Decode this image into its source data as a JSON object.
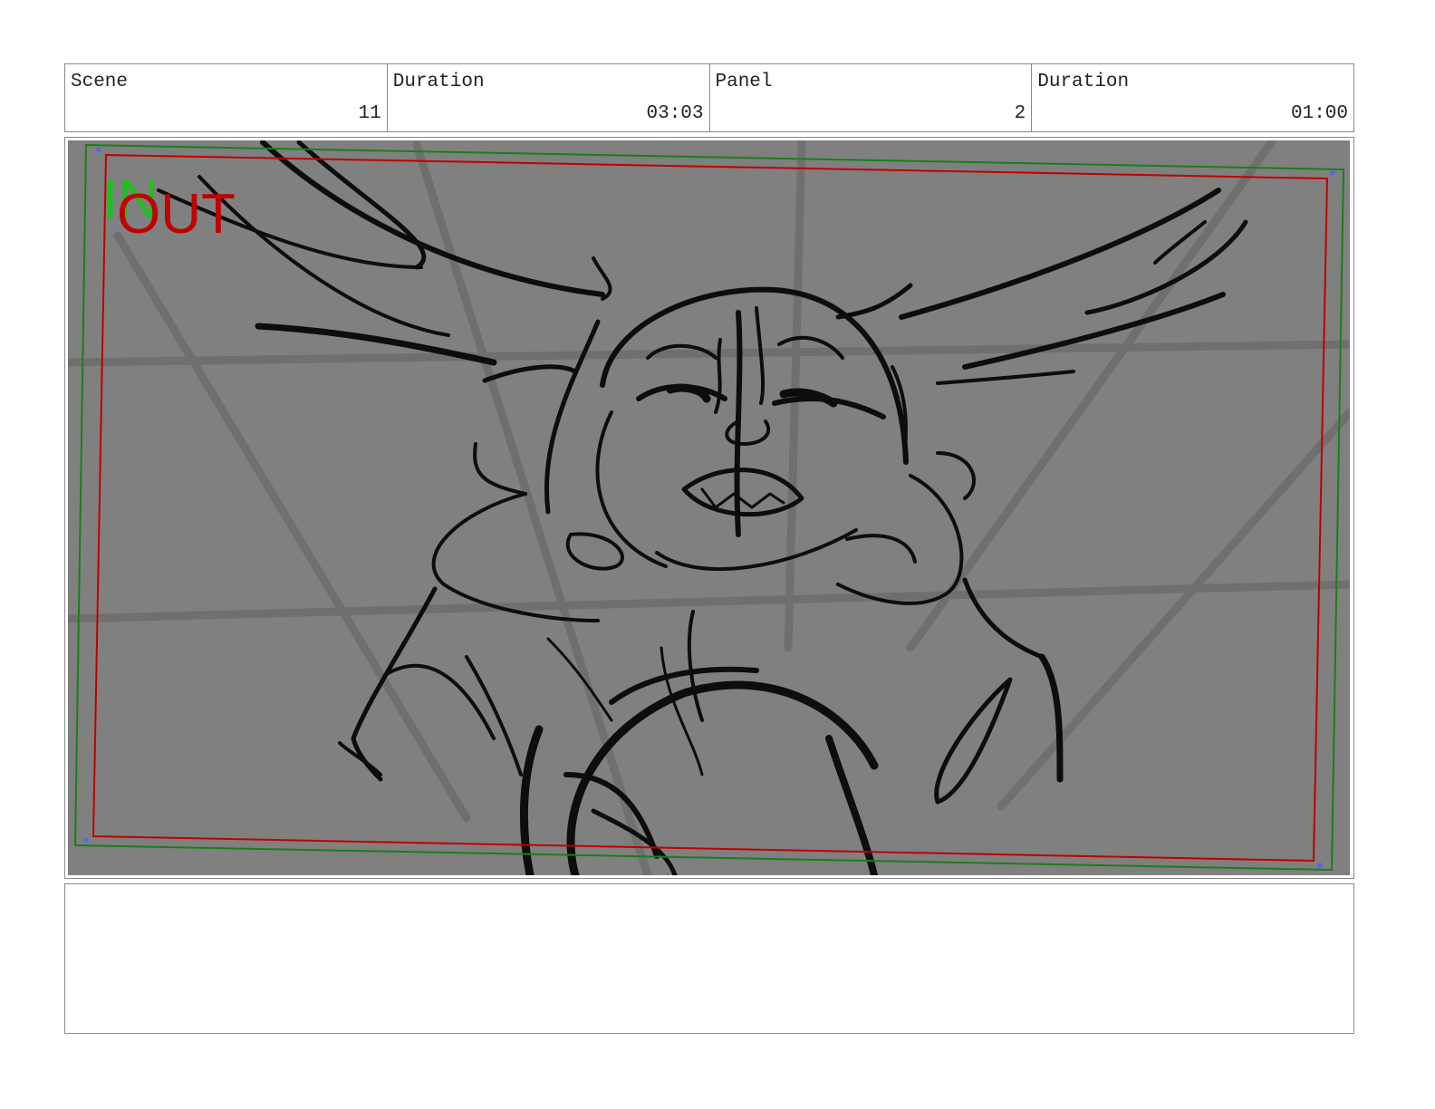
{
  "header": {
    "scene_label": "Scene",
    "scene_value": "11",
    "scene_duration_label": "Duration",
    "scene_duration_value": "03:03",
    "panel_label": "Panel",
    "panel_value": "2",
    "panel_duration_label": "Duration",
    "panel_duration_value": "01:00"
  },
  "panel": {
    "in_label": "IN",
    "out_label": "OUT",
    "in_color": "#1fbf1f",
    "out_color": "#c00000",
    "background_color": "#808080"
  },
  "notes": {
    "text": ""
  }
}
